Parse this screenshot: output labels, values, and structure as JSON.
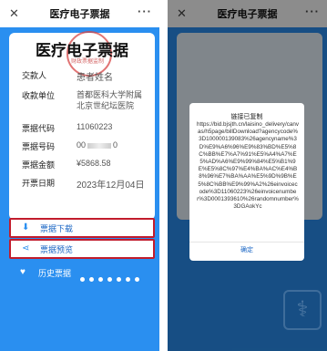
{
  "left": {
    "window_title": "医疗电子票据",
    "close_icon": "close-icon",
    "more_icon": "more-dots-icon",
    "card": {
      "title": "医疗电子票据",
      "seal_text": "财政票据监制",
      "rows": [
        {
          "label": "交款人",
          "value": "患者姓名"
        },
        {
          "label": "收款单位",
          "value": "首都医科大学附属北京世纪坛医院"
        },
        {
          "label": "票据代码",
          "value": "11060223"
        },
        {
          "label": "票据号码",
          "value_prefix": "00",
          "value_suffix": "0"
        },
        {
          "label": "票据金额",
          "value": "¥5868.58"
        },
        {
          "label": "开票日期",
          "value": "2023年12月04日"
        }
      ]
    },
    "menu": [
      {
        "label": "票据下载",
        "icon": "download-icon"
      },
      {
        "label": "票据预览",
        "icon": "share-icon"
      },
      {
        "label": "历史票据",
        "icon": "heart-icon"
      }
    ]
  },
  "right": {
    "window_title": "医疗电子票据",
    "dialog": {
      "title": "链接已复制",
      "body": "https://bid.bjsjth.cn/laisino_delivery/canvas/h5page/billDownload?agencycode%3D100000139083%26agencyname%3D%E9%A6%96%E9%83%BD%E5%8C%BB%E7%A7%91%E5%A4%A7%E5%AD%A6%E9%99%84%E5%B1%9E%E5%8C%97%E4%BA%AC%E4%B8%96%E7%BA%AA%E5%9D%9B%E5%8C%BB%E9%99%A2%26einvoicecode%3D11060223%26einvoicenumber%3D0001393610%26randomnumber%3DGAokYc",
      "ok_label": "确定"
    }
  },
  "colors": {
    "brand_blue": "#2a8ff0",
    "highlight_red": "#c21c2c"
  }
}
